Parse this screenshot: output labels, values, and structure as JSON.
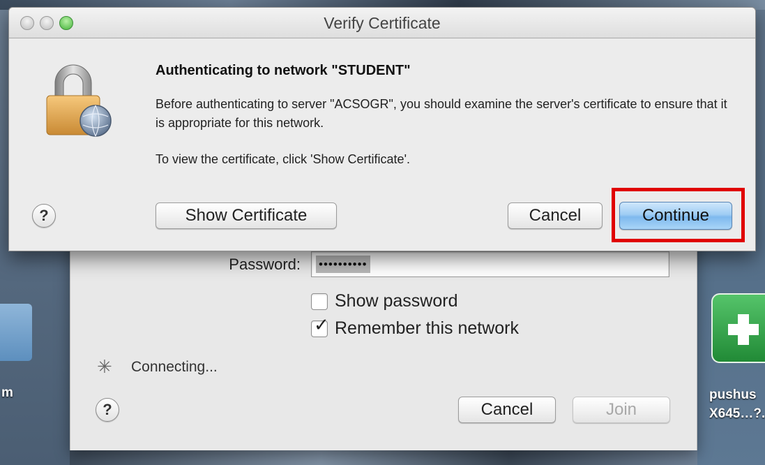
{
  "verify_window": {
    "title": "Verify Certificate",
    "heading": "Authenticating to network \"STUDENT\"",
    "message": "Before authenticating to server \"ACSOGR\", you should examine the server's certificate to ensure that it is appropriate for this network.",
    "instruction": "To view the certificate, click 'Show Certificate'.",
    "help_label": "?",
    "show_certificate_label": "Show Certificate",
    "cancel_label": "Cancel",
    "continue_label": "Continue"
  },
  "join_dialog": {
    "password_label": "Password:",
    "password_masked": "••••••••••",
    "show_password_label": "Show password",
    "show_password_checked": false,
    "remember_network_label": "Remember this network",
    "remember_network_checked": true,
    "status_text": "Connecting...",
    "help_label": "?",
    "cancel_label": "Cancel",
    "join_label": "Join"
  },
  "desktop": {
    "left_label": "m",
    "right_label_line1": "pushus",
    "right_label_line2": "X645…?."
  },
  "colors": {
    "highlight": "#e00000",
    "primary_button": "#9fcdf4",
    "close_button_green": "#44b33a"
  }
}
